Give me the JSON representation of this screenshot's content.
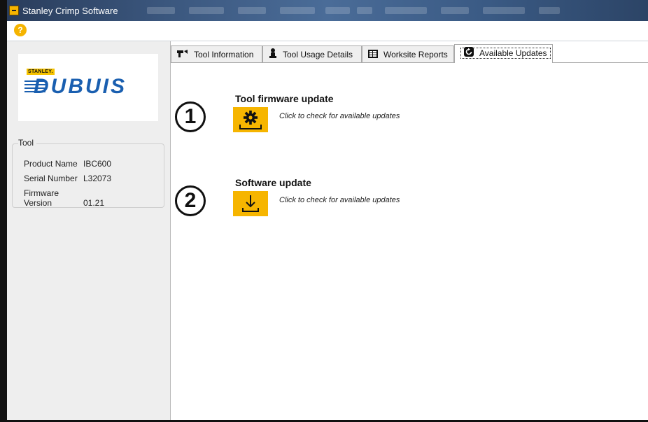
{
  "window": {
    "title": "Stanley Crimp Software"
  },
  "toolbar": {
    "help_icon_label": "?"
  },
  "sidebar": {
    "logo": {
      "brand": "STANLEY.",
      "product": "DUBUIS"
    },
    "group_label": "Tool",
    "fields": [
      {
        "label": "Product Name",
        "value": "IBC600"
      },
      {
        "label": "Serial Number",
        "value": "L32073"
      },
      {
        "label": "Firmware Version",
        "value": "01.21"
      }
    ]
  },
  "tabs": [
    {
      "label": "Tool Information",
      "icon": "tool-icon"
    },
    {
      "label": "Tool Usage Details",
      "icon": "worker-icon"
    },
    {
      "label": "Worksite Reports",
      "icon": "report-icon"
    },
    {
      "label": "Available Updates",
      "icon": "refresh-icon",
      "active": true
    }
  ],
  "updates": {
    "firmware": {
      "marker": "1",
      "title": "Tool firmware update",
      "hint": "Click to check for available updates",
      "icon": "gear-download-icon"
    },
    "software": {
      "marker": "2",
      "title": "Software update",
      "hint": "Click to check for available updates",
      "icon": "download-icon"
    }
  },
  "colors": {
    "accent": "#f6b500",
    "title_bar": "#3b577e",
    "logo_blue": "#1a5fb0"
  }
}
